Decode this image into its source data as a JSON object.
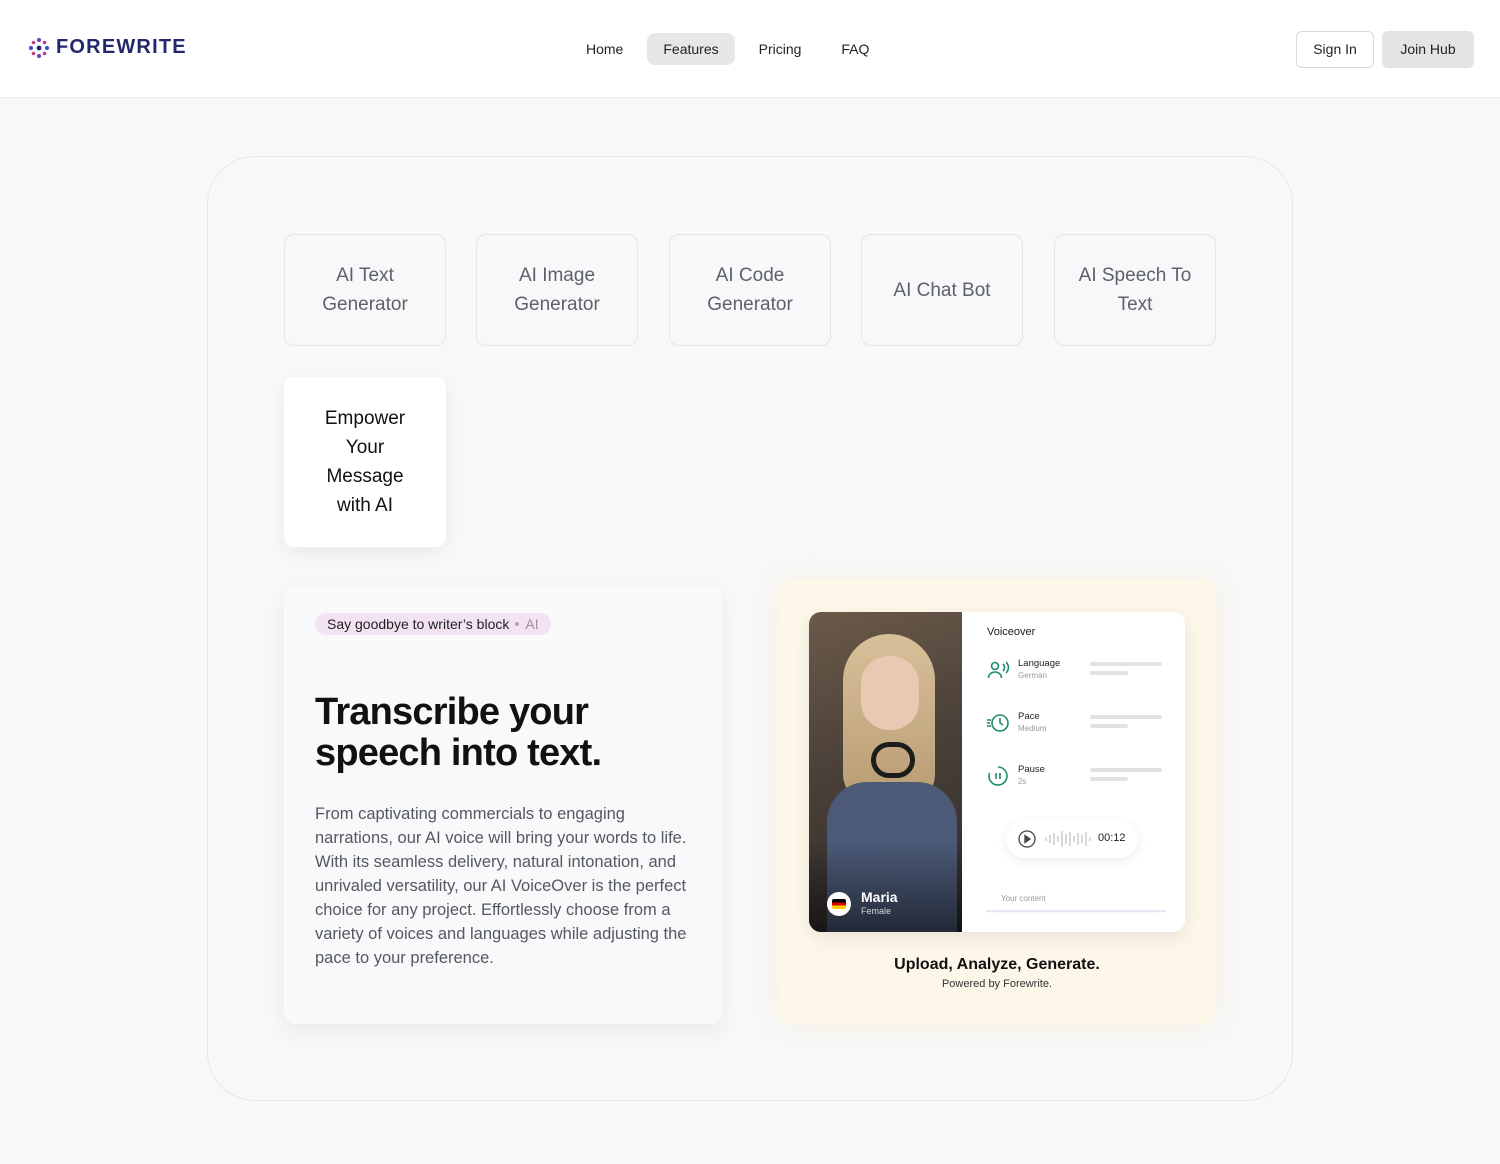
{
  "header": {
    "logo_text": "FOREWRITE",
    "nav": [
      {
        "label": "Home"
      },
      {
        "label": "Features"
      },
      {
        "label": "Pricing"
      },
      {
        "label": "FAQ"
      }
    ],
    "active_nav": "Features",
    "sign_in_label": "Sign In",
    "join_label": "Join Hub"
  },
  "features": {
    "tiles": [
      {
        "label": "AI Text Generator"
      },
      {
        "label": "AI Image Generator"
      },
      {
        "label": "AI Code Generator"
      },
      {
        "label": "AI Chat Bot"
      },
      {
        "label": "AI Speech To Text"
      }
    ],
    "active_tile": "Empower Your Message with AI"
  },
  "content": {
    "badge_text": "Say goodbye to writer’s block",
    "badge_tag": "AI",
    "headline": "Transcribe your speech into text.",
    "description": "From captivating commercials to engaging narrations, our AI voice will bring your words to life. With its seamless delivery, natural intonation, and unrivaled versatility, our AI VoiceOver is the perfect choice for any project. Effortlessly choose from a variety of voices and languages while adjusting the pace to your preference."
  },
  "preview": {
    "voice_name": "Maria",
    "voice_gender": "Female",
    "panel_title": "Voiceover",
    "options": [
      {
        "label": "Language",
        "value": "German"
      },
      {
        "label": "Pace",
        "value": "Medium"
      },
      {
        "label": "Pause",
        "value": "2s"
      }
    ],
    "player_time": "00:12",
    "content_placeholder": "Your content",
    "caption_title": "Upload, Analyze, Generate.",
    "caption_sub": "Powered by Forewrite."
  },
  "colors": {
    "brand": "#23286b",
    "badge_bg": "#f3e2f1",
    "preview_bg": "#fdf7ea",
    "icon_accent": "#1f8a6e"
  }
}
